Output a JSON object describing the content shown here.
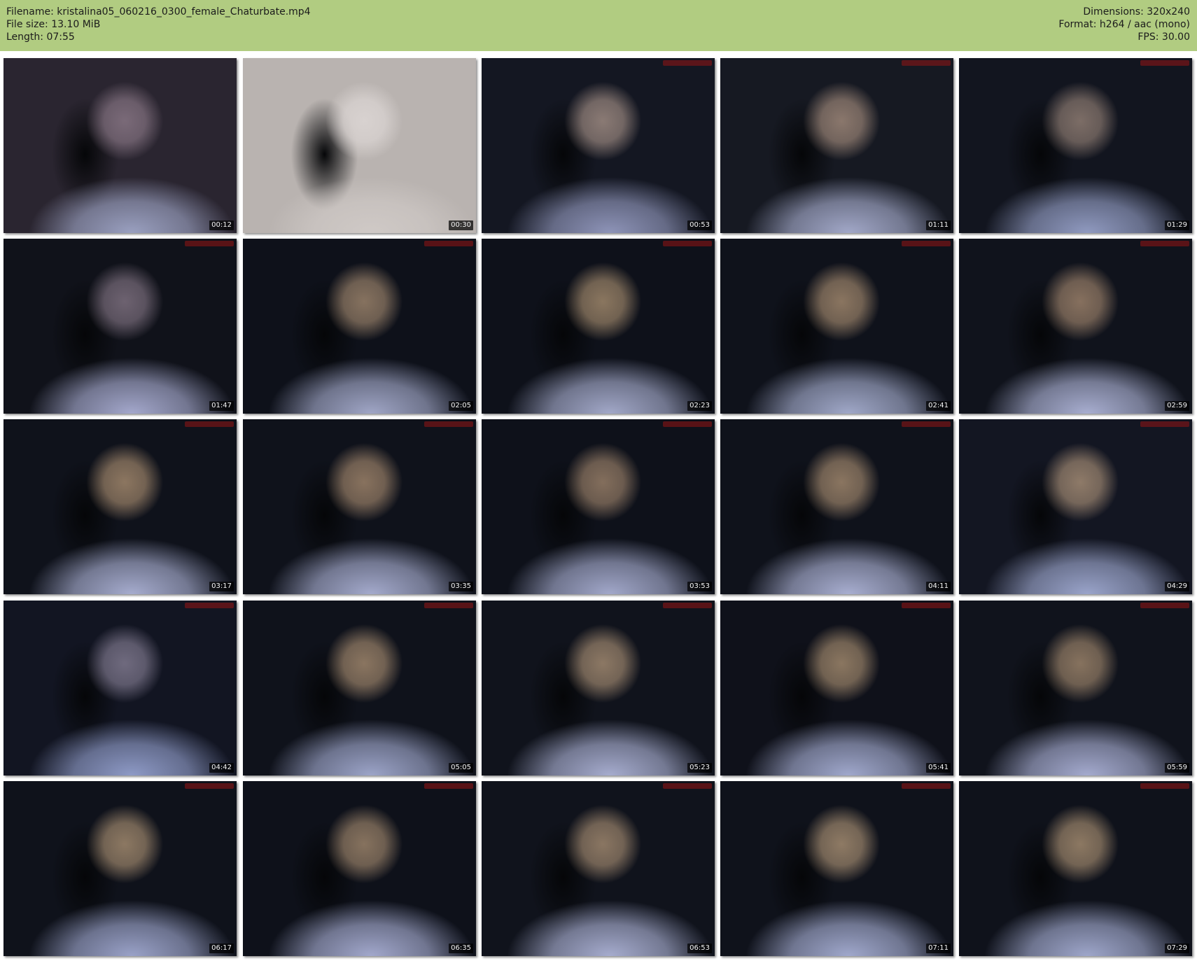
{
  "header": {
    "filename": "Filename: kristalina05_060216_0300_female_Chaturbate.mp4",
    "filesize": "File size: 13.10 MiB",
    "length": "Length: 07:55",
    "dimensions": "Dimensions: 320x240",
    "format": "Format: h264 / aac (mono)",
    "fps": "FPS: 30.00"
  },
  "thumbnails": [
    {
      "time": "00:12"
    },
    {
      "time": "00:30"
    },
    {
      "time": "00:53"
    },
    {
      "time": "01:11"
    },
    {
      "time": "01:29"
    },
    {
      "time": "01:47"
    },
    {
      "time": "02:05"
    },
    {
      "time": "02:23"
    },
    {
      "time": "02:41"
    },
    {
      "time": "02:59"
    },
    {
      "time": "03:17"
    },
    {
      "time": "03:35"
    },
    {
      "time": "03:53"
    },
    {
      "time": "04:11"
    },
    {
      "time": "04:29"
    },
    {
      "time": "04:42"
    },
    {
      "time": "05:05"
    },
    {
      "time": "05:23"
    },
    {
      "time": "05:41"
    },
    {
      "time": "05:59"
    },
    {
      "time": "06:17"
    },
    {
      "time": "06:35"
    },
    {
      "time": "06:53"
    },
    {
      "time": "07:11"
    },
    {
      "time": "07:29"
    }
  ]
}
